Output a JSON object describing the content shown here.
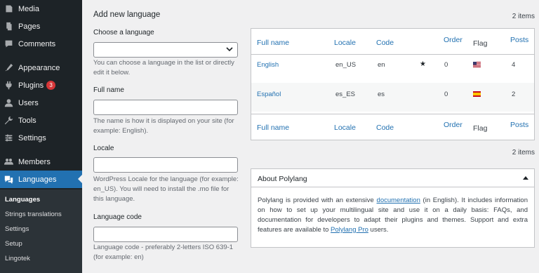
{
  "sidebar": {
    "items": [
      {
        "label": "Media",
        "icon": "media-icon"
      },
      {
        "label": "Pages",
        "icon": "pages-icon"
      },
      {
        "label": "Comments",
        "icon": "comments-icon"
      },
      {
        "label": "Appearance",
        "icon": "appearance-icon"
      },
      {
        "label": "Plugins",
        "icon": "plugins-icon",
        "badge": "3"
      },
      {
        "label": "Users",
        "icon": "users-icon"
      },
      {
        "label": "Tools",
        "icon": "tools-icon"
      },
      {
        "label": "Settings",
        "icon": "settings-icon"
      },
      {
        "label": "Members",
        "icon": "members-icon"
      },
      {
        "label": "Languages",
        "icon": "languages-icon"
      }
    ],
    "submenu": [
      "Languages",
      "Strings translations",
      "Settings",
      "Setup",
      "Lingotek"
    ]
  },
  "form": {
    "title": "Add new language",
    "choose_label": "Choose a language",
    "choose_value": "",
    "choose_desc": "You can choose a language in the list or directly edit it below.",
    "fullname_label": "Full name",
    "fullname_value": "",
    "fullname_desc": "The name is how it is displayed on your site (for example: English).",
    "locale_label": "Locale",
    "locale_value": "",
    "locale_desc": "WordPress Locale for the language (for example: en_US). You will need to install the .mo file for this language.",
    "code_label": "Language code",
    "code_value": "",
    "code_desc": "Language code - preferably 2-letters ISO 639-1 (for example: en)"
  },
  "table": {
    "count_top": "2 items",
    "count_bottom": "2 items",
    "headers": {
      "full_name": "Full name",
      "locale": "Locale",
      "code": "Code",
      "order": "Order",
      "flag": "Flag",
      "posts": "Posts"
    },
    "rows": [
      {
        "name": "English",
        "locale": "en_US",
        "code": "en",
        "default": "★",
        "order": "0",
        "flag": "us-flag-icon",
        "posts": "4"
      },
      {
        "name": "Español",
        "locale": "es_ES",
        "code": "es",
        "default": "",
        "order": "0",
        "flag": "es-flag-icon",
        "posts": "2"
      }
    ]
  },
  "about": {
    "title": "About Polylang",
    "text1": "Polylang is provided with an extensive ",
    "link1": "documentation",
    "text2": " (in English). It includes information on how to set up your multilingual site and use it on a daily basis: FAQs, and documentation for developers to adapt their plugins and themes. Support and extra features are available to ",
    "link2": "Polylang Pro",
    "text3": " users."
  }
}
